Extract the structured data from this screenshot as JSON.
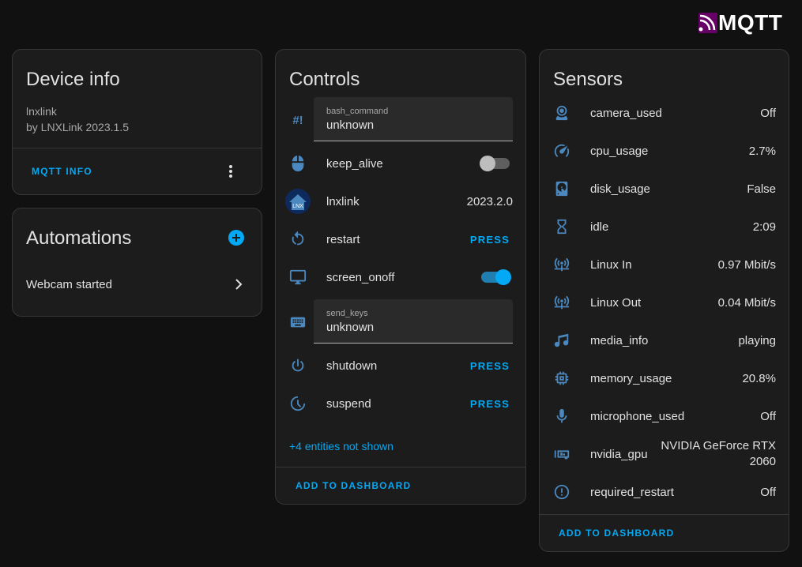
{
  "brand": {
    "logo_text": "MQTT"
  },
  "device_info": {
    "title": "Device info",
    "name": "lnxlink",
    "by_line": "by LNXLink 2023.1.5",
    "mqtt_info_label": "MQTT INFO"
  },
  "automations": {
    "title": "Automations",
    "items": [
      {
        "label": "Webcam started"
      }
    ]
  },
  "controls": {
    "title": "Controls",
    "rows": [
      {
        "name": "bash_command",
        "type": "text",
        "value": "unknown",
        "icon": "hash-bang-icon"
      },
      {
        "name": "keep_alive",
        "type": "toggle",
        "state": "off",
        "icon": "mouse-icon"
      },
      {
        "name": "lnxlink",
        "type": "value",
        "value": "2023.2.0",
        "icon": "lnxlink-logo-icon"
      },
      {
        "name": "restart",
        "type": "button",
        "value": "PRESS",
        "icon": "restart-icon"
      },
      {
        "name": "screen_onoff",
        "type": "toggle",
        "state": "on",
        "icon": "monitor-icon"
      },
      {
        "name": "send_keys",
        "type": "text",
        "value": "unknown",
        "icon": "keyboard-icon"
      },
      {
        "name": "shutdown",
        "type": "button",
        "value": "PRESS",
        "icon": "power-icon"
      },
      {
        "name": "suspend",
        "type": "button",
        "value": "PRESS",
        "icon": "sleep-icon"
      }
    ],
    "hidden_entities": "+4 entities not shown",
    "add_to_dashboard": "ADD TO DASHBOARD"
  },
  "sensors": {
    "title": "Sensors",
    "rows": [
      {
        "name": "camera_used",
        "value": "Off",
        "icon": "webcam-icon"
      },
      {
        "name": "cpu_usage",
        "value": "2.7%",
        "icon": "speedometer-icon"
      },
      {
        "name": "disk_usage",
        "value": "False",
        "icon": "harddisk-icon"
      },
      {
        "name": "idle",
        "value": "2:09",
        "icon": "hourglass-icon"
      },
      {
        "name": "Linux In",
        "value": "0.97 Mbit/s",
        "icon": "access-point-network-icon"
      },
      {
        "name": "Linux Out",
        "value": "0.04 Mbit/s",
        "icon": "access-point-network-icon"
      },
      {
        "name": "media_info",
        "value": "playing",
        "icon": "music-icon"
      },
      {
        "name": "memory_usage",
        "value": "20.8%",
        "icon": "memory-chip-icon"
      },
      {
        "name": "microphone_used",
        "value": "Off",
        "icon": "microphone-icon"
      },
      {
        "name": "nvidia_gpu",
        "value_line1": "NVIDIA GeForce RTX",
        "value_line2": "2060",
        "icon": "gpu-icon"
      },
      {
        "name": "required_restart",
        "value": "Off",
        "icon": "alert-circle-icon"
      }
    ],
    "add_to_dashboard": "ADD TO DASHBOARD"
  },
  "colors": {
    "accent": "#03a9f4",
    "icon": "#4a88bf",
    "card": "#1c1c1c",
    "background": "#111111"
  }
}
